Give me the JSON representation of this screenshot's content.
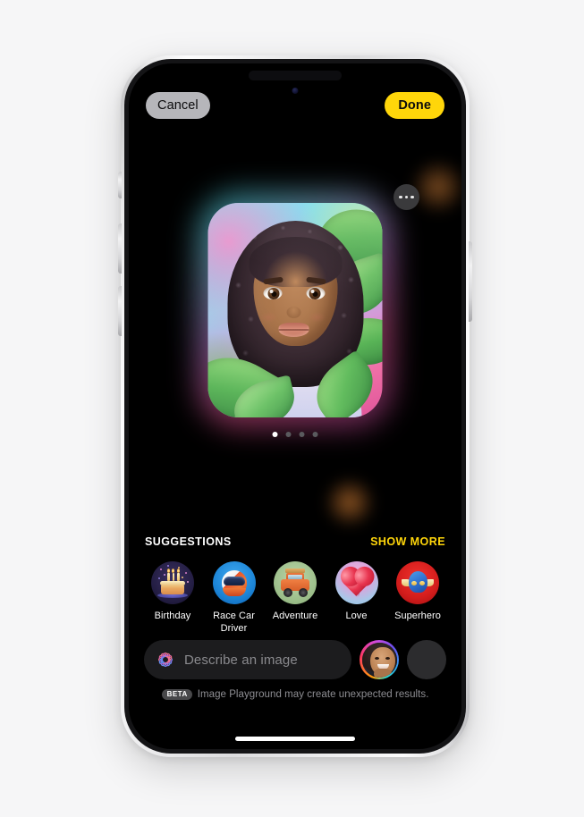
{
  "app": {
    "name": "Image Playground",
    "device": "iPhone",
    "background_color": "#f6f6f7",
    "accent_color": "#ffd60a"
  },
  "top_bar": {
    "cancel_label": "Cancel",
    "done_label": "Done",
    "cancel_bg": "#b6b6ba",
    "done_bg": "#ffd60a"
  },
  "canvas": {
    "more_button_name": "more-options",
    "image_alt": "Generated illustration of a smiling girl with curly dark hair surrounded by green leaves",
    "page_dots": {
      "count": 4,
      "active_index": 0
    }
  },
  "suggestions": {
    "title": "SUGGESTIONS",
    "show_more_label": "SHOW MORE",
    "items": [
      {
        "label": "Birthday",
        "icon": "birthday-cake-icon"
      },
      {
        "label": "Race Car Driver",
        "icon": "racing-helmet-icon"
      },
      {
        "label": "Adventure",
        "icon": "off-road-suv-icon"
      },
      {
        "label": "Love",
        "icon": "heart-icon"
      },
      {
        "label": "Superhero",
        "icon": "superhero-mask-icon"
      }
    ]
  },
  "input_bar": {
    "prompt_placeholder": "Describe an image",
    "prompt_value": "",
    "leading_icon": "apple-intelligence-icon",
    "avatar_name": "person-avatar",
    "add_button_icon": "plus-icon"
  },
  "footnote": {
    "badge": "BETA",
    "text": "Image Playground may create unexpected results."
  }
}
